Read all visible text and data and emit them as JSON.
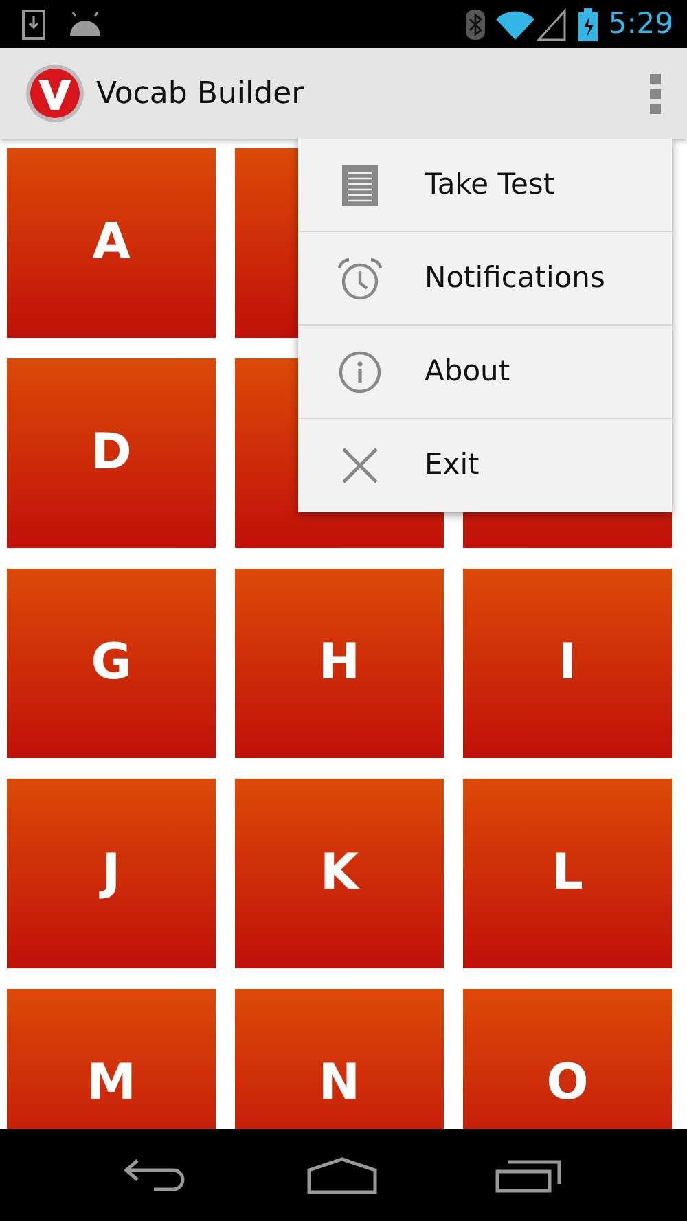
{
  "status_bar": {
    "time": "5:29"
  },
  "action_bar": {
    "title": "Vocab Builder"
  },
  "tiles": [
    {
      "kind": "letter",
      "letter": "A"
    },
    {
      "kind": "covered"
    },
    {
      "kind": "hidden"
    },
    {
      "kind": "letter",
      "letter": "D"
    },
    {
      "kind": "covered"
    },
    {
      "kind": "covered"
    },
    {
      "kind": "letter",
      "letter": "G"
    },
    {
      "kind": "letter",
      "letter": "H"
    },
    {
      "kind": "letter",
      "letter": "I"
    },
    {
      "kind": "letter",
      "letter": "J"
    },
    {
      "kind": "letter",
      "letter": "K"
    },
    {
      "kind": "letter",
      "letter": "L"
    },
    {
      "kind": "letter",
      "letter": "M"
    },
    {
      "kind": "letter",
      "letter": "N"
    },
    {
      "kind": "letter",
      "letter": "O"
    }
  ],
  "menu": [
    {
      "kind": "test",
      "label": "Take Test"
    },
    {
      "kind": "alarm",
      "label": "Notifications"
    },
    {
      "kind": "info",
      "label": "About"
    },
    {
      "kind": "exit",
      "label": "Exit"
    }
  ]
}
